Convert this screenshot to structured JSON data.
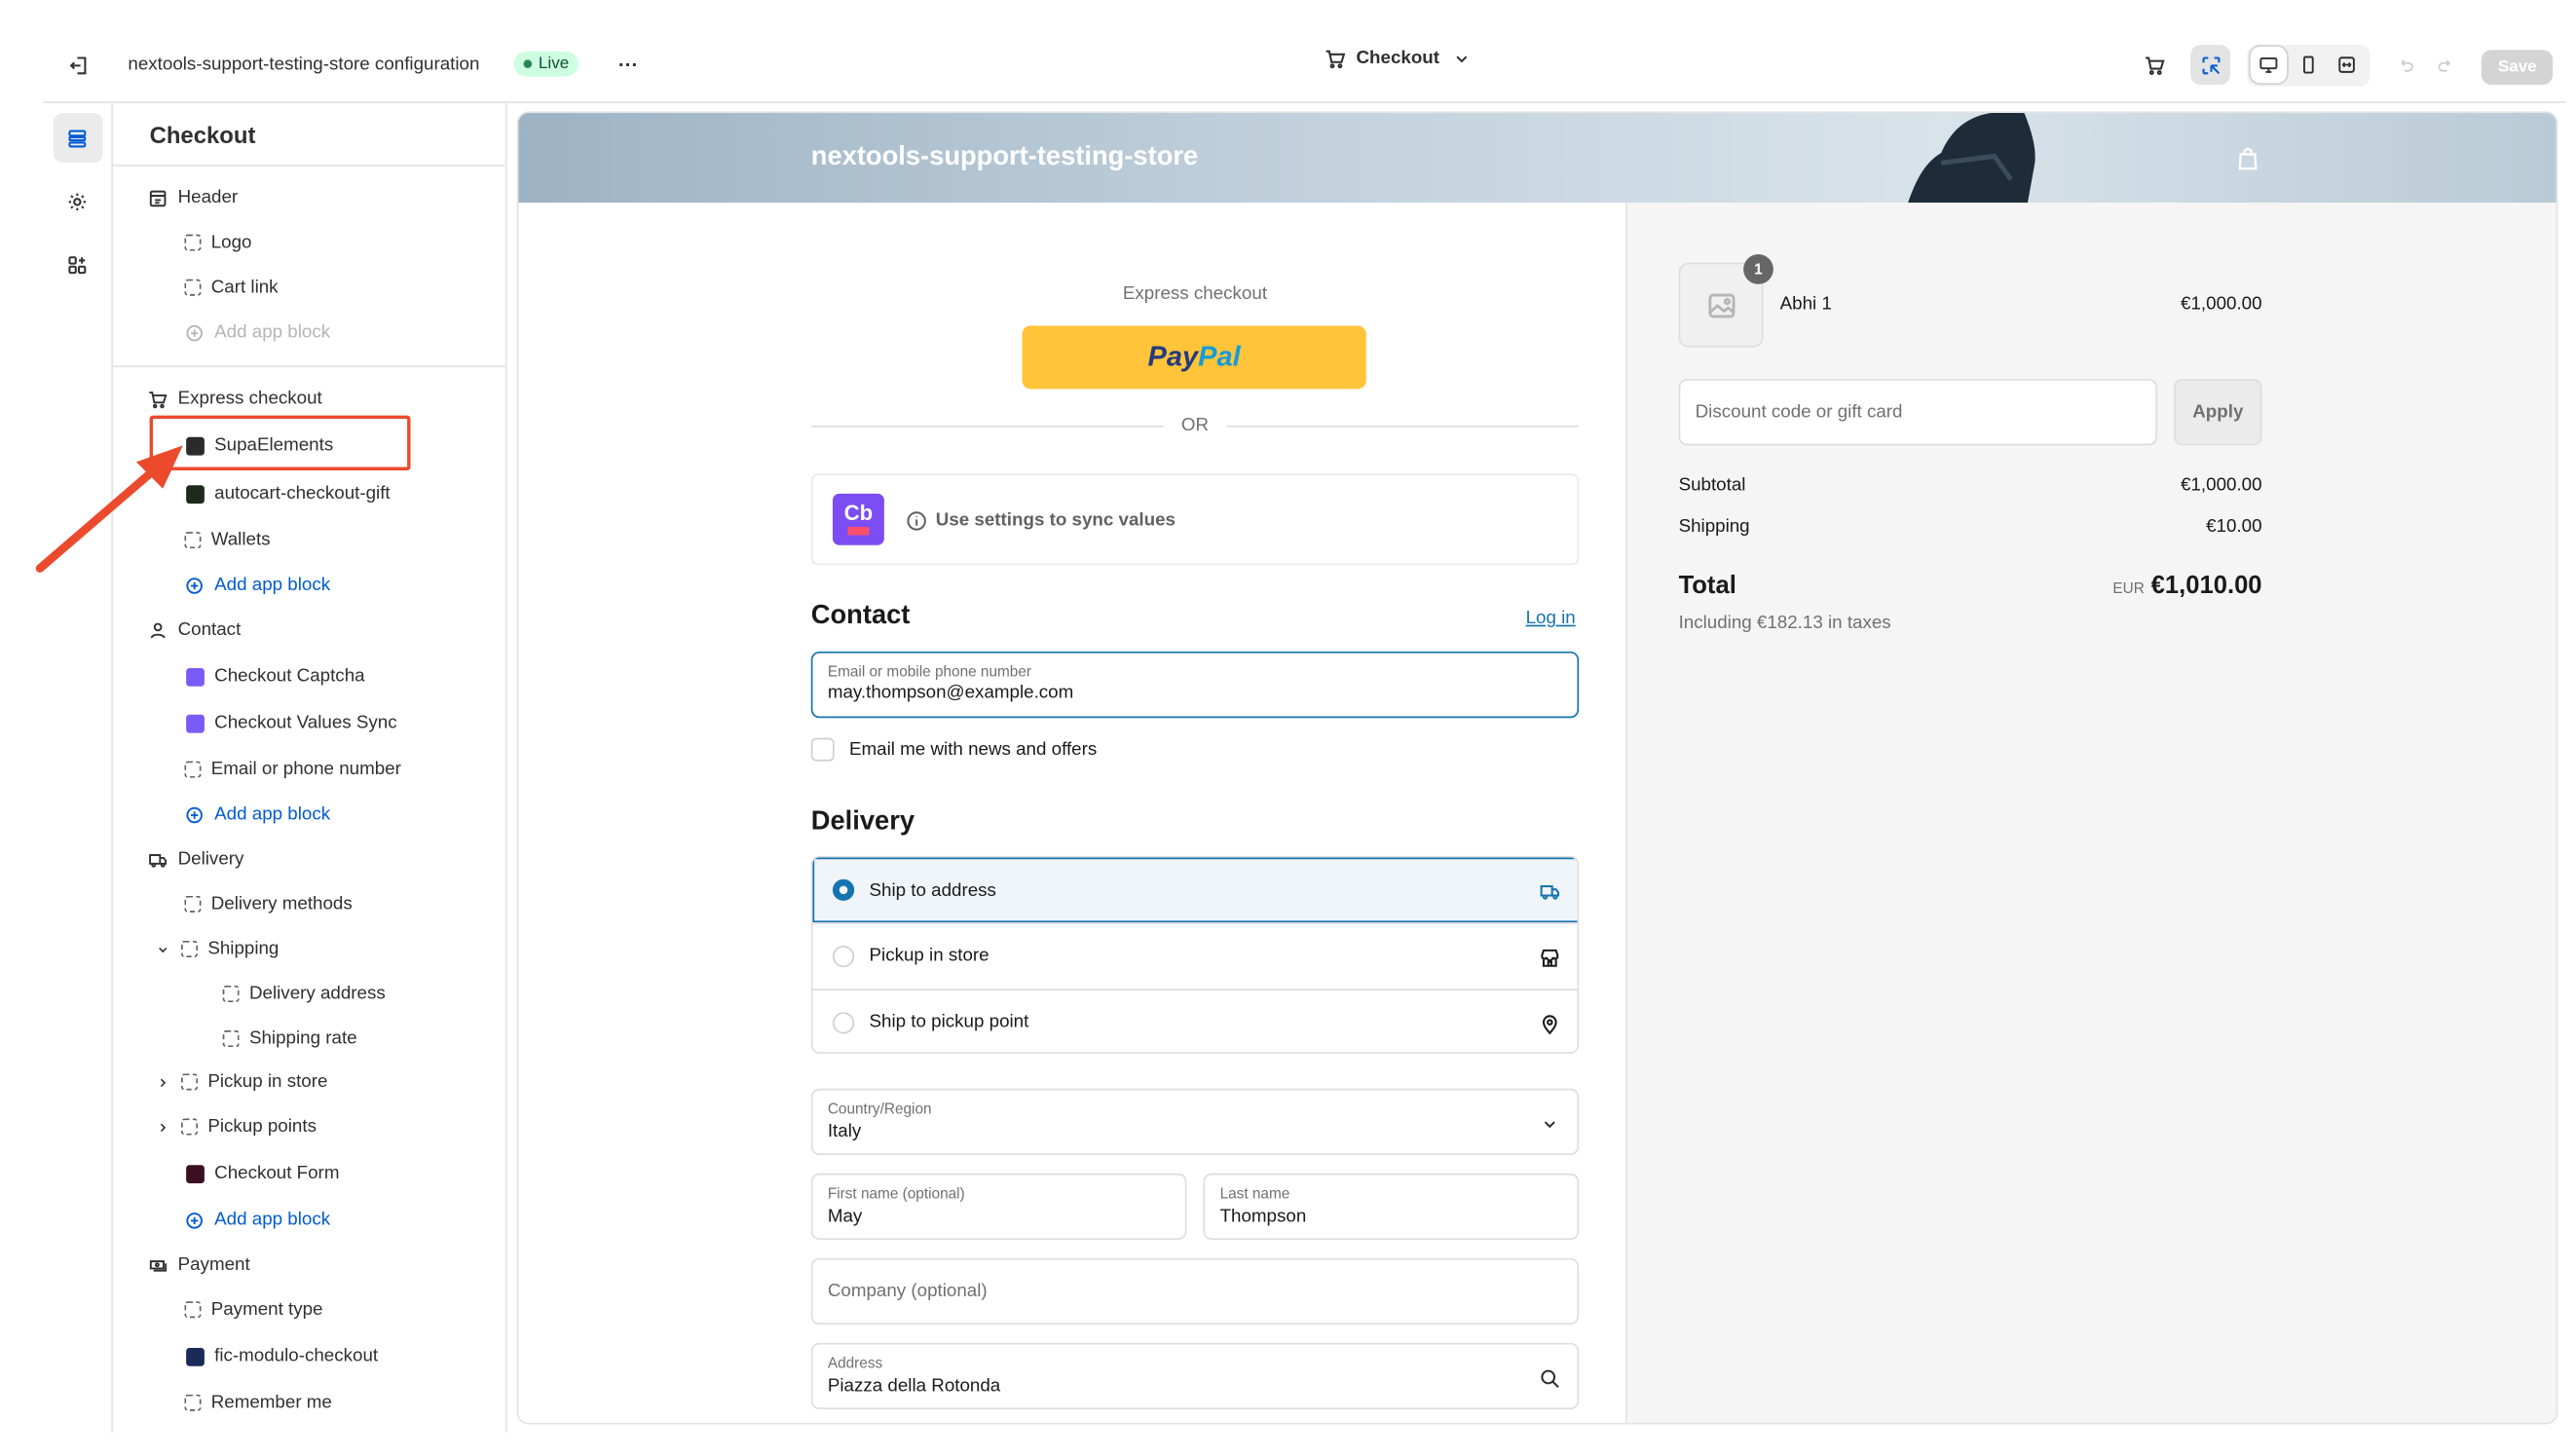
{
  "topbar": {
    "store_config": "nextools-support-testing-store configuration",
    "live_badge": "Live",
    "more_label": "···",
    "page_selector": "Checkout",
    "save_label": "Save"
  },
  "sidebar": {
    "title": "Checkout",
    "header_section": {
      "label": "Header",
      "items": [
        "Logo",
        "Cart link"
      ],
      "add_block": "Add app block"
    },
    "express_section": {
      "label": "Express checkout",
      "items": [
        "SupaElements",
        "autocart-checkout-gift",
        "Wallets"
      ],
      "add_block": "Add app block"
    },
    "contact_section": {
      "label": "Contact",
      "items": [
        "Checkout Captcha",
        "Checkout Values Sync",
        "Email or phone number"
      ],
      "add_block": "Add app block"
    },
    "delivery_section": {
      "label": "Delivery",
      "items": [
        "Delivery methods",
        "Shipping",
        "Delivery address",
        "Shipping rate",
        "Pickup in store",
        "Pickup points",
        "Checkout Form"
      ],
      "add_block": "Add app block"
    },
    "payment_section": {
      "label": "Payment",
      "items": [
        "Payment type",
        "fic-modulo-checkout",
        "Remember me"
      ]
    }
  },
  "preview": {
    "store_name": "nextools-support-testing-store",
    "express_checkout_label": "Express checkout",
    "paypal_pay": "Pay",
    "paypal_pal": "Pal",
    "or_label": "OR",
    "cb_logo": "Cb",
    "sync_notice": "Use settings to sync values",
    "contact_title": "Contact",
    "login_link": "Log in",
    "email_label": "Email or mobile phone number",
    "email_value": "may.thompson@example.com",
    "newsletter_label": "Email me with news and offers",
    "delivery_title": "Delivery",
    "delivery_options": [
      "Ship to address",
      "Pickup in store",
      "Ship to pickup point"
    ],
    "country_label": "Country/Region",
    "country_value": "Italy",
    "first_name_label": "First name (optional)",
    "first_name_value": "May",
    "last_name_label": "Last name",
    "last_name_value": "Thompson",
    "company_placeholder": "Company (optional)",
    "address_label": "Address",
    "address_value": "Piazza della Rotonda"
  },
  "summary": {
    "qty_badge": "1",
    "product_name": "Abhi 1",
    "product_price": "€1,000.00",
    "discount_placeholder": "Discount code or gift card",
    "apply_label": "Apply",
    "subtotal_label": "Subtotal",
    "subtotal_value": "€1,000.00",
    "shipping_label": "Shipping",
    "shipping_value": "€10.00",
    "total_label": "Total",
    "currency": "EUR",
    "total_value": "€1,010.00",
    "tax_note": "Including €182.13 in taxes"
  },
  "colors": {
    "accent": "#1773b0",
    "annotation": "#ec4a2c",
    "paypal": "#ffc439",
    "live": "#cdfee1",
    "link": "#005bd3"
  }
}
